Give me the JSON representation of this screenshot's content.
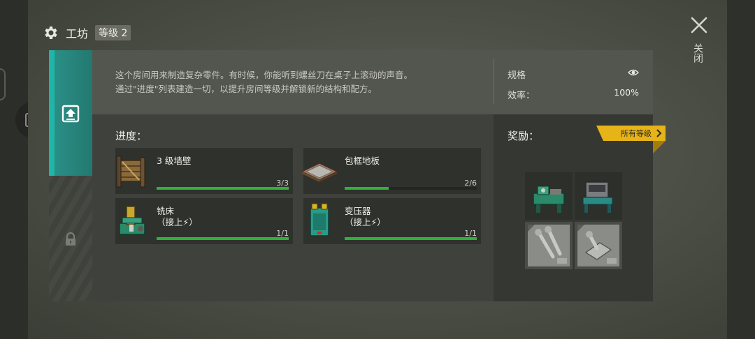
{
  "header": {
    "title": "工坊",
    "level_label": "等级 2",
    "close_label": "关闭"
  },
  "description": {
    "line1": "这个房间用来制造复杂零件。有时候，你能听到螺丝刀在桌子上滚动的声音。",
    "line2": "通过\"进度\"列表建造一切，以提升房间等级并解锁新的结构和配方。"
  },
  "stats": {
    "spec_label": "规格",
    "efficiency_label": "效率：",
    "efficiency_value": "100%"
  },
  "progress": {
    "title": "进度：",
    "items": [
      {
        "name": "3 级墙壁",
        "sub": "",
        "count": "3/3",
        "fraction": 1.0,
        "icon": "wall-icon"
      },
      {
        "name": "包框地板",
        "sub": "",
        "count": "2/6",
        "fraction": 0.3333,
        "icon": "floor-icon"
      },
      {
        "name": "铣床",
        "sub": "（接上⚡）",
        "count": "1/1",
        "fraction": 1.0,
        "icon": "milling-machine-icon"
      },
      {
        "name": "变压器",
        "sub": "（接上⚡）",
        "count": "1/1",
        "fraction": 1.0,
        "icon": "transformer-icon"
      }
    ]
  },
  "rewards": {
    "title": "奖励：",
    "all_levels_label": "所有等级",
    "items": [
      "lathe-icon",
      "workbench-icon",
      "screws-blueprint-icon",
      "bracket-blueprint-icon"
    ]
  },
  "colors": {
    "accent_teal": "#1fb5a8",
    "progress_green": "#2fb23a",
    "badge_yellow": "#e6b318"
  }
}
